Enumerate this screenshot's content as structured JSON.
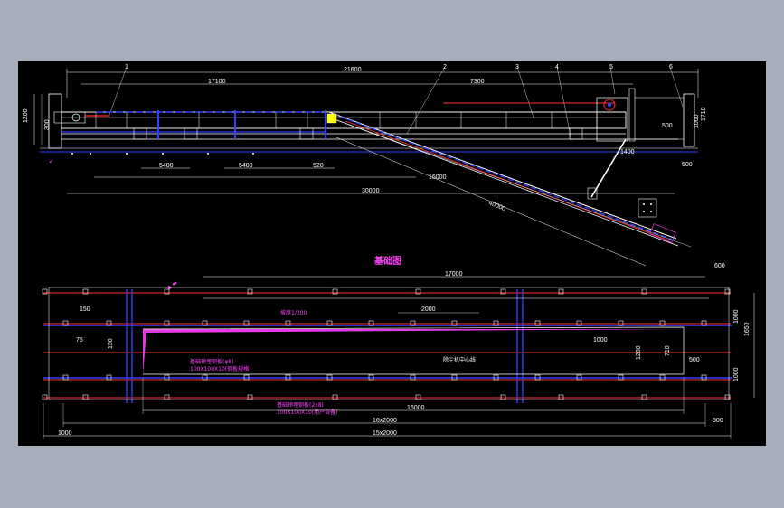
{
  "drawing": {
    "plan_title": "基础图",
    "side_view": {
      "part_labels": [
        "1",
        "2",
        "3",
        "4",
        "5",
        "6"
      ],
      "dims": {
        "overall_top": "21600",
        "seg_a": "17100",
        "seg_b": "7300",
        "h_left": "1200",
        "h_left2": "300",
        "h_right": "1710",
        "h_right2": "1000",
        "span1": "5400",
        "span2": "5400",
        "small1": "520",
        "bottom_total": "30000",
        "incline_len": "16000",
        "incline_len2": "40000",
        "right_a": "500",
        "right_b": "1400",
        "right_c": "500"
      }
    },
    "plan_view": {
      "dims": {
        "top_span": "17000",
        "mid_span": "2000",
        "top_right_a": "600",
        "right_v1": "1650",
        "right_v2": "1000",
        "right_v3": "1000",
        "left_a": "150",
        "left_b": "75",
        "left_v": "150",
        "inner_a": "1000",
        "inner_b": "500",
        "inner_v1": "1200",
        "inner_v2": "710",
        "bottom_a": "16000",
        "bottom_b": "16x2000",
        "bottom_c": "15x2000",
        "left_end": "1000",
        "right_end": "500"
      },
      "notes": {
        "slope": "坡度1/300",
        "center": "除尘机中心线",
        "emb_1": "基础预埋钢板(φ8)",
        "emb_2": "100X100X10(钢板规格)",
        "emb_3": "基础预埋钢板(2x8)",
        "emb_4": "100X100X10(用户自备)"
      }
    }
  }
}
